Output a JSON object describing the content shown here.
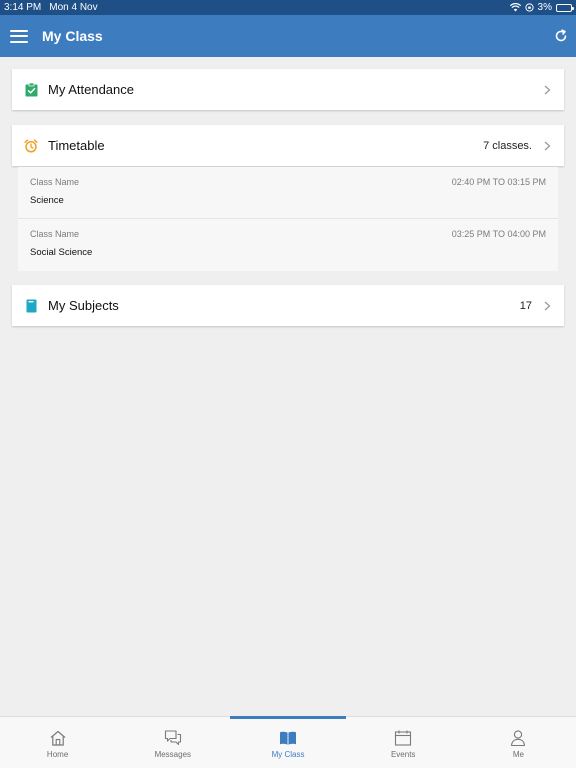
{
  "status_bar": {
    "time": "3:14 PM",
    "date": "Mon 4 Nov",
    "battery": "3%"
  },
  "nav": {
    "title": "My Class"
  },
  "attendance": {
    "title": "My Attendance"
  },
  "timetable": {
    "title": "Timetable",
    "count": "7 classes.",
    "items": [
      {
        "label": "Class Name",
        "name": "Science",
        "time": "02:40 PM TO 03:15 PM"
      },
      {
        "label": "Class Name",
        "name": "Social Science",
        "time": "03:25 PM TO 04:00 PM"
      }
    ]
  },
  "subjects": {
    "title": "My Subjects",
    "count": "17"
  },
  "tabs": [
    {
      "label": "Home",
      "icon": "home-icon"
    },
    {
      "label": "Messages",
      "icon": "messages-icon"
    },
    {
      "label": "My Class",
      "icon": "book-icon",
      "active": true
    },
    {
      "label": "Events",
      "icon": "calendar-icon"
    },
    {
      "label": "Me",
      "icon": "user-icon"
    }
  ],
  "colors": {
    "primary": "#3e7cc0",
    "status_bar": "#1f4f87",
    "attendance_icon": "#2eaa6a",
    "timetable_icon": "#f0a020",
    "subjects_icon": "#1fa7c4"
  }
}
